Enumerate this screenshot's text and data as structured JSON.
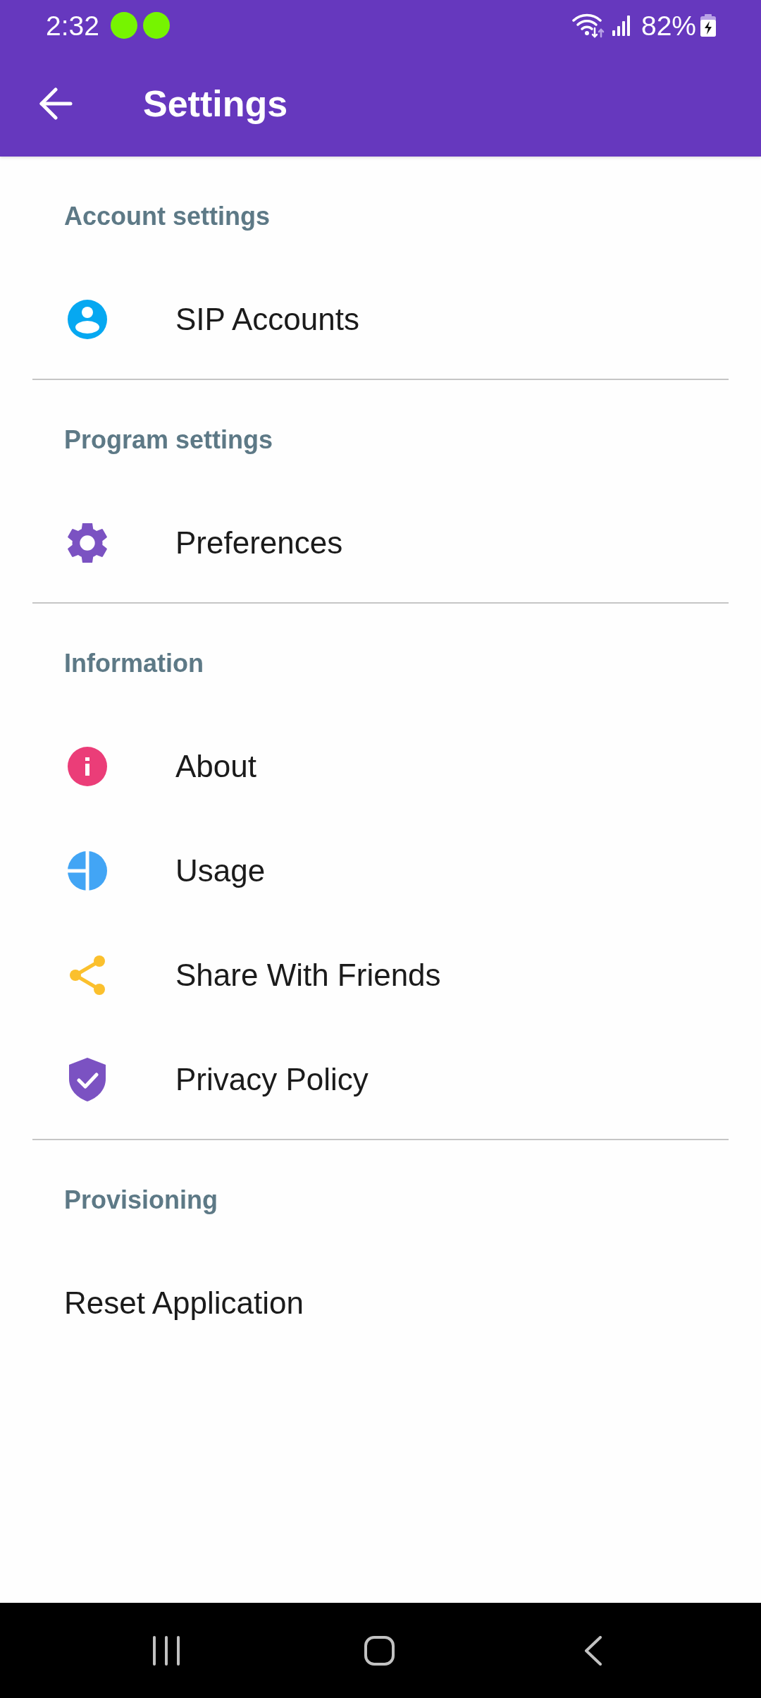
{
  "status_bar": {
    "time": "2:32",
    "battery": "82%"
  },
  "app_bar": {
    "title": "Settings"
  },
  "sections": [
    {
      "header": "Account settings",
      "items": [
        "SIP Accounts"
      ]
    },
    {
      "header": "Program settings",
      "items": [
        "Preferences"
      ]
    },
    {
      "header": "Information",
      "items": [
        "About",
        "Usage",
        "Share With Friends",
        "Privacy Policy"
      ]
    },
    {
      "header": "Provisioning",
      "items": [
        "Reset Application"
      ]
    }
  ]
}
